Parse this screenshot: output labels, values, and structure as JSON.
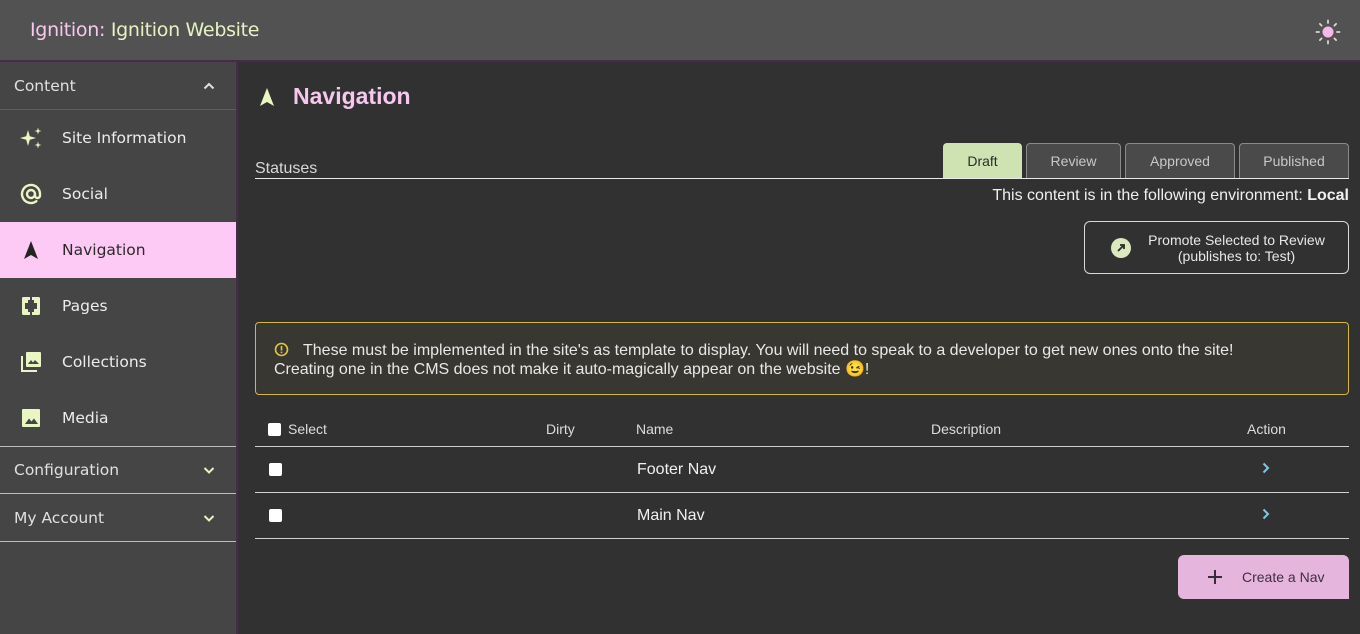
{
  "app": {
    "title_prefix": "Ignition:",
    "title_site": " Ignition Website",
    "theme_toggle_icon": "sun-icon"
  },
  "sidebar": {
    "sections": [
      {
        "label": "Content",
        "expanded": true,
        "icon": "chevron-up-icon"
      },
      {
        "label": "Configuration",
        "expanded": false,
        "icon": "chevron-down-icon"
      },
      {
        "label": "My Account",
        "expanded": false,
        "icon": "chevron-down-icon"
      }
    ],
    "items": [
      {
        "label": "Site Information",
        "icon": "sparkles-icon",
        "active": false
      },
      {
        "label": "Social",
        "icon": "at-sign-icon",
        "active": false
      },
      {
        "label": "Navigation",
        "icon": "navigation-arrow-icon",
        "active": true
      },
      {
        "label": "Pages",
        "icon": "pages-icon",
        "active": false
      },
      {
        "label": "Collections",
        "icon": "collections-icon",
        "active": false
      },
      {
        "label": "Media",
        "icon": "image-icon",
        "active": false
      }
    ]
  },
  "main": {
    "title": "Navigation",
    "title_icon": "navigation-arrow-icon",
    "statuses_label": "Statuses",
    "tabs": [
      {
        "label": "Draft",
        "active": true
      },
      {
        "label": "Review",
        "active": false
      },
      {
        "label": "Approved",
        "active": false
      },
      {
        "label": "Published",
        "active": false
      }
    ],
    "environment_prefix": "This content is in the following environment: ",
    "environment_value": "Local",
    "promote_button": {
      "line1": "Promote Selected to Review",
      "line2": "(publishes to: Test)",
      "icon": "arrow-up-right-circle-icon"
    },
    "alert": {
      "icon": "warning-circle-icon",
      "line1": "These must be implemented in the site's as template to display. You will need to speak to a developer to get new ones onto the site!",
      "line2": "Creating one in the CMS does not make it auto-magically appear on the website 😉!"
    },
    "table": {
      "columns": [
        "Select",
        "Dirty",
        "Name",
        "Description",
        "Action"
      ],
      "rows": [
        {
          "selected": false,
          "dirty": "",
          "name": "Footer Nav",
          "description": ""
        },
        {
          "selected": false,
          "dirty": "",
          "name": "Main Nav",
          "description": ""
        }
      ]
    },
    "create_button": {
      "label": "Create a Nav",
      "icon": "plus-icon"
    }
  },
  "colors": {
    "accent_pink": "#fdc9f5",
    "accent_green": "#cfe3b2",
    "alert_border": "#d4b83a",
    "action_chevron": "#7ec8e3"
  }
}
